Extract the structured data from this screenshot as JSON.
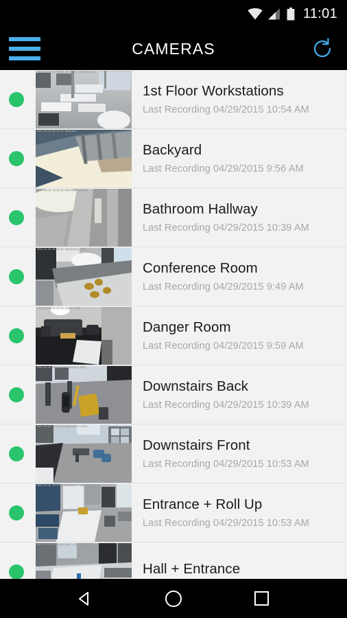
{
  "status_bar": {
    "time": "11:01",
    "icons": [
      "wifi-icon",
      "cellular-signal-icon",
      "battery-icon"
    ]
  },
  "app_bar": {
    "menu_icon": "hamburger-menu-icon",
    "title": "CAMERAS",
    "refresh_icon": "refresh-icon",
    "accent_color": "#4aaeea",
    "background_color": "#000000"
  },
  "list": {
    "subtitle_prefix": "Last Recording",
    "online_color": "#29c46c",
    "background_color": "#f2f2f2",
    "cameras": [
      {
        "name": "1st Floor Workstations",
        "subtitle": "Last Recording 04/29/2015 10:54 AM",
        "status": "online",
        "thumb_osd": "2015-04-29 10:54:09\n1st Floor Workstations"
      },
      {
        "name": "Backyard",
        "subtitle": "Last Recording 04/29/2015 9:56 AM",
        "status": "online",
        "thumb_osd": "2015-04-29 09:56:41\nBackyard"
      },
      {
        "name": "Bathroom Hallway",
        "subtitle": "Last Recording 04/29/2015 10:39 AM",
        "status": "online",
        "thumb_osd": "2015-04-29 10:39:15\nBathroom Hallway"
      },
      {
        "name": "Conference Room",
        "subtitle": "Last Recording 04/29/2015 9:49 AM",
        "status": "online",
        "thumb_osd": "2015-04-29 09:49:22\nConference Room"
      },
      {
        "name": "Danger Room",
        "subtitle": "Last Recording 04/29/2015 9:59 AM",
        "status": "online",
        "thumb_osd": "2015-04-29 09:59:03\nDanger Room"
      },
      {
        "name": "Downstairs Back",
        "subtitle": "Last Recording 04/29/2015 10:39 AM",
        "status": "online",
        "thumb_osd": "2015-04-29 10:39:51\nDownstairs Back"
      },
      {
        "name": "Downstairs Front",
        "subtitle": "Last Recording 04/29/2015 10:53 AM",
        "status": "online",
        "thumb_osd": "2015-04-29 10:53:18\nDownstairs Front"
      },
      {
        "name": "Entrance + Roll Up",
        "subtitle": "Last Recording 04/29/2015 10:53 AM",
        "status": "online",
        "thumb_osd": "2015-04-29 10:53:44\nEntrance + Roll Up"
      },
      {
        "name": "Hall + Entrance",
        "subtitle": "",
        "status": "online",
        "thumb_osd": "2015-04-29 10:53:59\nHall + Entrance"
      }
    ]
  },
  "nav_bar": {
    "back_icon": "back-triangle-icon",
    "home_icon": "home-circle-icon",
    "recents_icon": "recents-square-icon"
  }
}
